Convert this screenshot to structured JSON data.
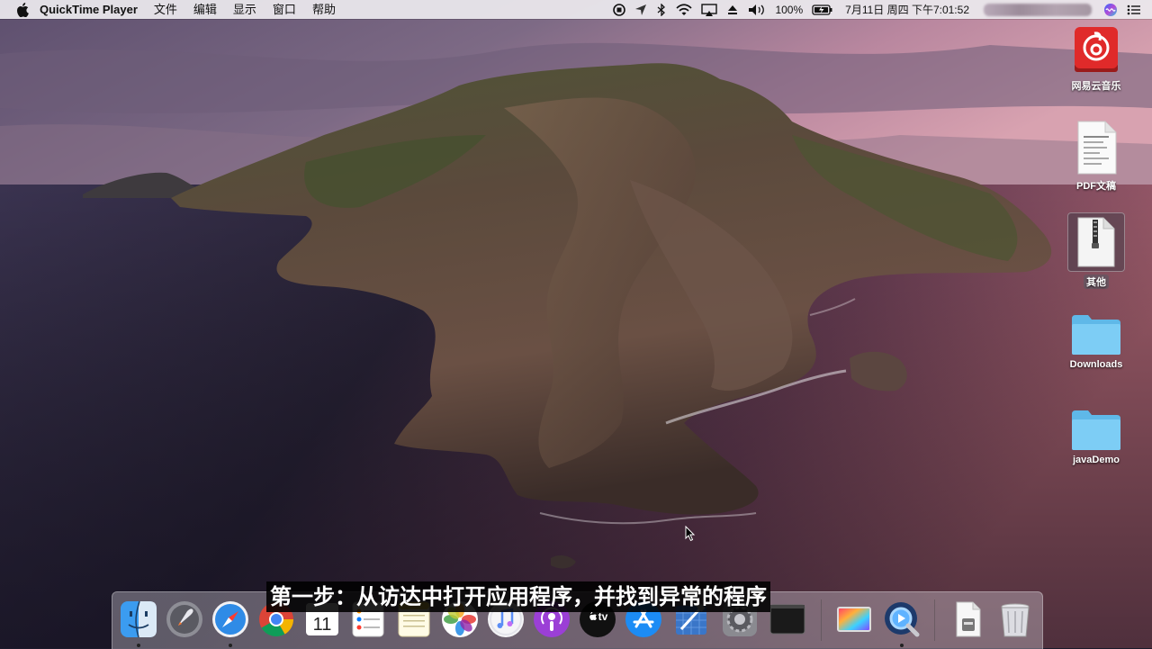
{
  "menubar": {
    "apple_icon": "apple-icon",
    "app_name": "QuickTime Player",
    "menus": [
      "文件",
      "编辑",
      "显示",
      "窗口",
      "帮助"
    ],
    "battery": "100%",
    "datetime": "7月11日 周四 下午7:01:52",
    "status_icons": [
      "record-stop-icon",
      "location-arrow-icon",
      "bluetooth-icon",
      "wifi-icon",
      "airplay-icon",
      "eject-icon",
      "volume-icon",
      "battery-charging-icon",
      "siri-icon",
      "list-icon"
    ]
  },
  "desktop": {
    "icons": [
      {
        "label": "网易云音乐",
        "icon": "netease-music-icon",
        "selected": false
      },
      {
        "label": "PDF文稿",
        "icon": "pdf-document-icon",
        "selected": false
      },
      {
        "label": "其他",
        "icon": "zip-file-icon",
        "selected": true
      },
      {
        "label": "Downloads",
        "icon": "folder-icon",
        "selected": false
      },
      {
        "label": "javaDemo",
        "icon": "folder-icon",
        "selected": false
      }
    ]
  },
  "subtitle": "第一步：从访达中打开应用程序，并找到异常的程序",
  "dock": {
    "apps": [
      {
        "name": "finder-icon",
        "running": true
      },
      {
        "name": "launchpad-icon",
        "running": false
      },
      {
        "name": "safari-icon",
        "running": true
      },
      {
        "name": "chrome-icon",
        "running": false
      },
      {
        "name": "calendar-icon",
        "running": false,
        "text": "11"
      },
      {
        "name": "reminders-icon",
        "running": false
      },
      {
        "name": "notes-icon",
        "running": false
      },
      {
        "name": "photos-icon",
        "running": false
      },
      {
        "name": "music-icon",
        "running": false
      },
      {
        "name": "podcasts-icon",
        "running": false
      },
      {
        "name": "apple-tv-icon",
        "running": false,
        "text": "tv"
      },
      {
        "name": "app-store-icon",
        "running": false
      },
      {
        "name": "xcode-icon",
        "running": false
      },
      {
        "name": "system-preferences-icon",
        "running": false
      },
      {
        "name": "terminal-icon",
        "running": false
      },
      {
        "name": "screen-recorder-icon",
        "running": false
      },
      {
        "name": "quicktime-icon",
        "running": true
      },
      {
        "name": "file-document-icon",
        "running": false
      },
      {
        "name": "trash-icon",
        "running": false
      }
    ]
  }
}
